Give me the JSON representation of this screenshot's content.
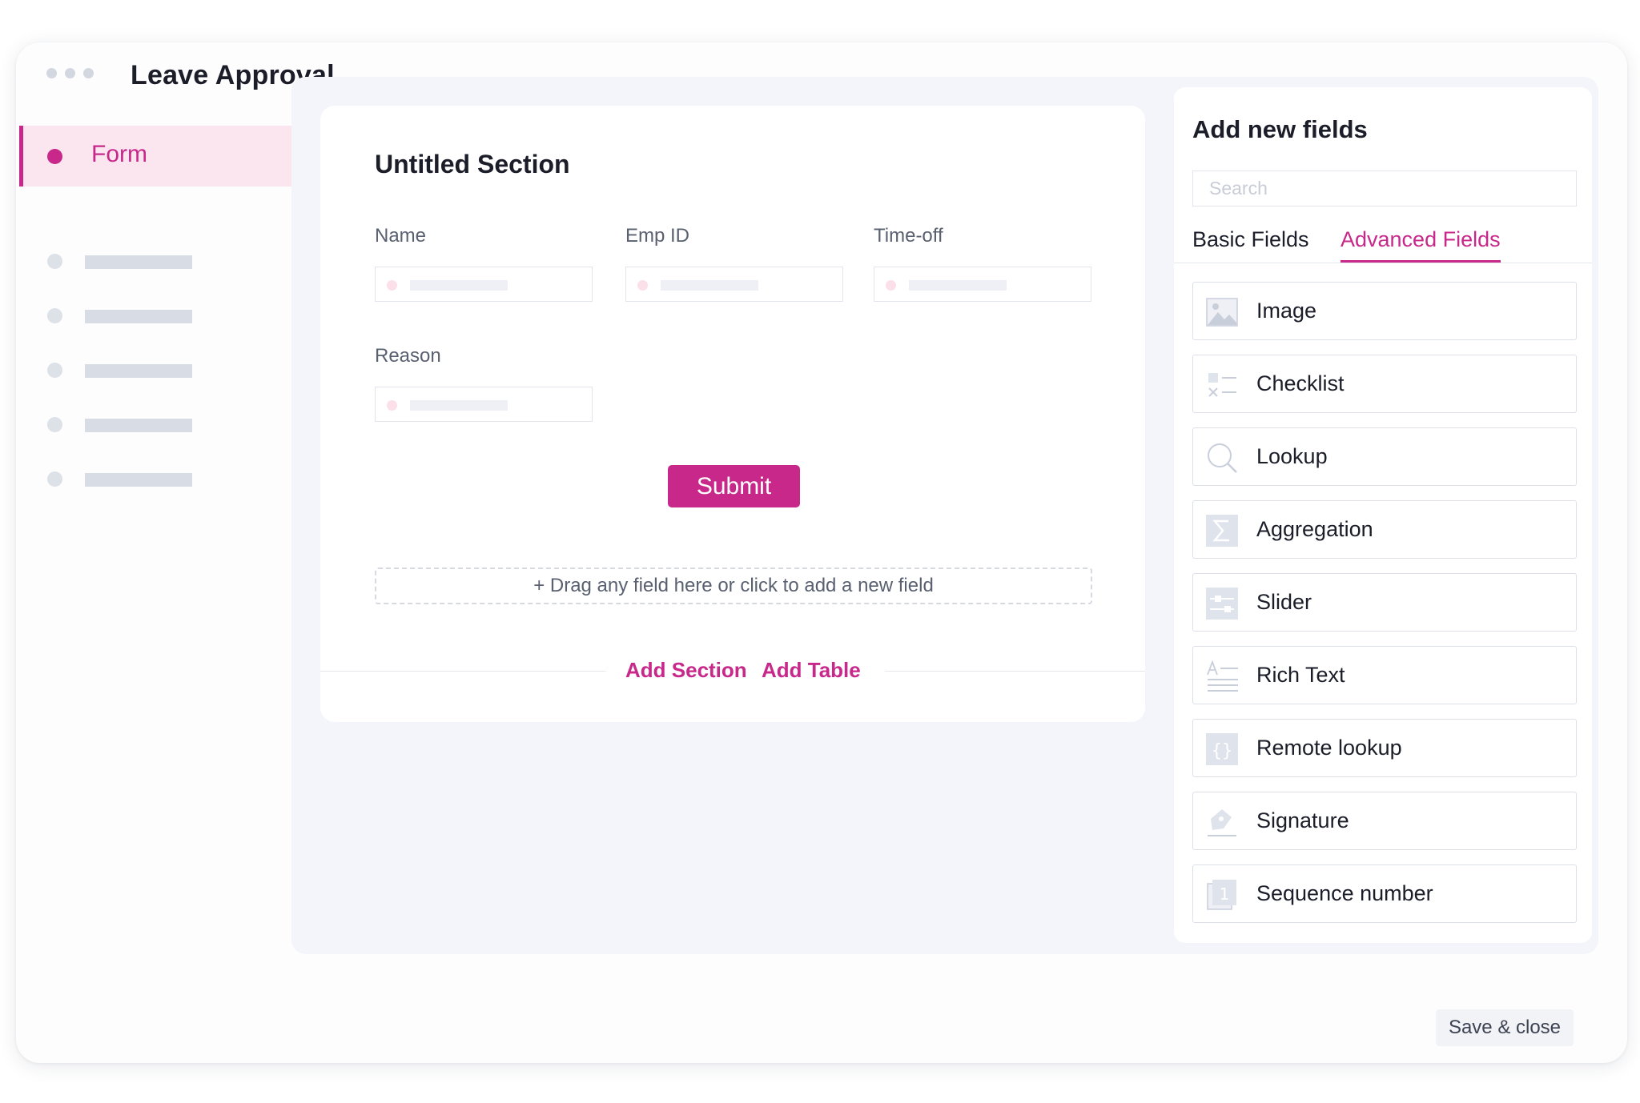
{
  "app": {
    "title": "Leave Approval"
  },
  "sidebar": {
    "items": [
      {
        "label": "Form",
        "active": true
      }
    ]
  },
  "form": {
    "section_title": "Untitled Section",
    "fields": [
      {
        "label": "Name"
      },
      {
        "label": "Emp ID"
      },
      {
        "label": "Time-off"
      },
      {
        "label": "Reason"
      }
    ],
    "submit_label": "Submit",
    "dropzone_text": "+ Drag any field here or click to add a new field",
    "add_section_label": "Add Section",
    "add_table_label": "Add Table"
  },
  "panel": {
    "title": "Add new fields",
    "search_placeholder": "Search",
    "tabs": [
      {
        "label": "Basic Fields",
        "active": false
      },
      {
        "label": "Advanced Fields",
        "active": true
      }
    ],
    "items": [
      {
        "label": "Image",
        "icon": "image-icon"
      },
      {
        "label": "Checklist",
        "icon": "checklist-icon"
      },
      {
        "label": "Lookup",
        "icon": "lookup-icon"
      },
      {
        "label": "Aggregation",
        "icon": "sigma-icon"
      },
      {
        "label": "Slider",
        "icon": "slider-icon"
      },
      {
        "label": "Rich Text",
        "icon": "rich-text-icon"
      },
      {
        "label": "Remote lookup",
        "icon": "braces-icon"
      },
      {
        "label": "Signature",
        "icon": "signature-icon"
      },
      {
        "label": "Sequence number",
        "icon": "sequence-number-icon"
      }
    ]
  },
  "footer": {
    "save_close_label": "Save & close"
  },
  "colors": {
    "accent": "#c7288a",
    "accent_light": "#fbe6ef",
    "canvas_bg": "#f3f5fa"
  }
}
